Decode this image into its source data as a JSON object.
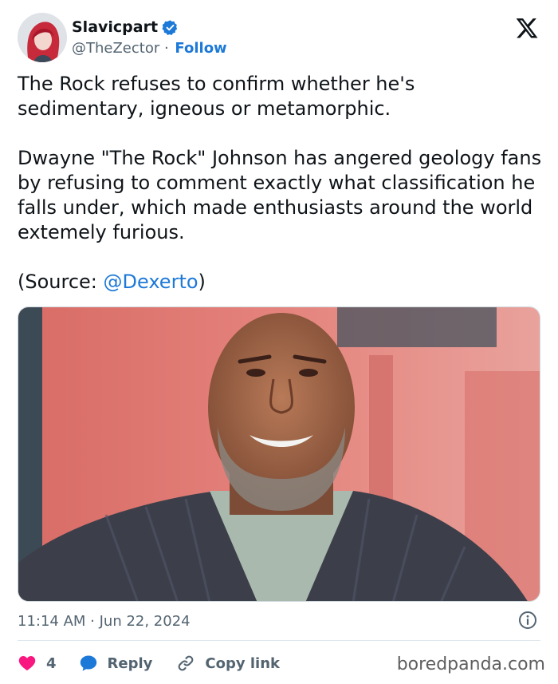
{
  "user": {
    "display_name": "Slavicpart",
    "handle": "@TheZector",
    "separator": " · ",
    "follow_label": "Follow"
  },
  "tweet": {
    "line1": "The Rock refuses to confirm whether he's sedimentary, igneous or metamorphic.",
    "line2": "Dwayne \"The Rock\" Johnson has angered geology fans by refusing to comment exactly what classification he falls under, which made enthusiasts around the world extemely furious.",
    "source_prefix": "(Source: ",
    "source_mention": "@Dexerto",
    "source_suffix": ")"
  },
  "meta": {
    "timestamp": "11:14 AM · Jun 22, 2024"
  },
  "actions": {
    "like_count": "4",
    "reply_label": "Reply",
    "copy_link_label": "Copy link"
  },
  "watermark": "boredpanda.com",
  "colors": {
    "accent": "#1d79d8",
    "like": "#f91880",
    "text": "#0f1419",
    "muted": "#536471"
  }
}
